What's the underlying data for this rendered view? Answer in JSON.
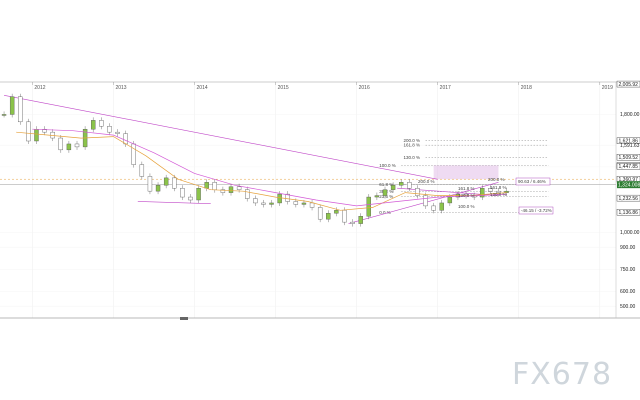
{
  "chart_data": {
    "type": "line",
    "title": "",
    "xlabel": "",
    "ylabel": "",
    "x_tick_labels": [
      "2012",
      "2013",
      "2014",
      "2015",
      "2016",
      "2017",
      "2018",
      "2019"
    ],
    "x_range": [
      2011.6,
      2019.2
    ],
    "y_range": [
      420,
      2020
    ],
    "y_price_labels": [
      {
        "value": 2005.92,
        "text": "2,005.92",
        "style": "box"
      },
      {
        "value": 1800,
        "text": "1,800.00",
        "style": "plain"
      },
      {
        "value": 1621.86,
        "text": "1,621.86",
        "style": "box"
      },
      {
        "value": 1591.63,
        "text": "1,591.63",
        "style": "plain"
      },
      {
        "value": 1509.52,
        "text": "1,509.52",
        "style": "box"
      },
      {
        "value": 1444.43,
        "text": "1,444.43",
        "style": "plain"
      },
      {
        "value": 1454.55,
        "text": "1,454.55",
        "style": "box"
      },
      {
        "value": 1447.85,
        "text": "1,447.85",
        "style": "box"
      },
      {
        "value": 1360.97,
        "text": "1,360.97",
        "style": "box"
      },
      {
        "value": 1324.008,
        "text": "1,324.008",
        "style": "current"
      },
      {
        "value": 1232.56,
        "text": "1,232.56",
        "style": "box"
      },
      {
        "value": 1136.86,
        "text": "1,136.86",
        "style": "box"
      },
      {
        "value": 1000,
        "text": "1,000.00",
        "style": "plain"
      },
      {
        "value": 900,
        "text": "900.00",
        "style": "plain"
      },
      {
        "value": 750,
        "text": "750.00",
        "style": "plain"
      },
      {
        "value": 600,
        "text": "600.00",
        "style": "plain"
      },
      {
        "value": 500,
        "text": "500.00",
        "style": "plain"
      }
    ],
    "fib_levels": [
      {
        "label": "200.0 %",
        "value": 1621.86
      },
      {
        "label": "161.8 %",
        "value": 1591.63
      },
      {
        "label": "130.0 %",
        "value": 1509.52
      },
      {
        "label": "100.0 %",
        "value": 1454.55
      },
      {
        "label": "61.8 %",
        "value": 1324.0
      },
      {
        "label": "38.2 %",
        "value": 1276.0
      },
      {
        "label": "23.6 %",
        "value": 1245.0
      },
      {
        "label": "0.0 %",
        "value": 1136.86
      }
    ],
    "annotations": [
      {
        "text": "200.0 %"
      },
      {
        "text": "200.0 %"
      },
      {
        "text": "161.8 %"
      },
      {
        "text": "161.8 %"
      },
      {
        "text": "130.0 %"
      },
      {
        "text": "130.0 %"
      },
      {
        "text": "100.0 %"
      },
      {
        "text": "90.63 / 6.46%"
      },
      {
        "text": "-46.15 / -3.72%"
      }
    ],
    "series": [
      {
        "name": "",
        "color": "#8bc34a",
        "style": "candles",
        "x": [
          2011.65,
          2011.75,
          2011.85,
          2011.95,
          2012.05,
          2012.15,
          2012.25,
          2012.35,
          2012.45,
          2012.55,
          2012.65,
          2012.75,
          2012.85,
          2012.95,
          2013.05,
          2013.15,
          2013.25,
          2013.35,
          2013.45,
          2013.55,
          2013.65,
          2013.75,
          2013.85,
          2013.95,
          2014.05,
          2014.15,
          2014.25,
          2014.35,
          2014.45,
          2014.55,
          2014.65,
          2014.75,
          2014.85,
          2014.95,
          2015.05,
          2015.15,
          2015.25,
          2015.35,
          2015.45,
          2015.55,
          2015.65,
          2015.75,
          2015.85,
          2015.95,
          2016.05,
          2016.15,
          2016.25,
          2016.35,
          2016.45,
          2016.55,
          2016.65,
          2016.75,
          2016.85,
          2016.95,
          2017.05,
          2017.15,
          2017.25,
          2017.35,
          2017.45,
          2017.55,
          2017.65,
          2017.75,
          2017.85
        ],
        "y": [
          1800,
          1920,
          1750,
          1620,
          1700,
          1680,
          1640,
          1560,
          1600,
          1580,
          1700,
          1760,
          1720,
          1680,
          1670,
          1600,
          1460,
          1380,
          1280,
          1320,
          1370,
          1300,
          1240,
          1220,
          1300,
          1340,
          1290,
          1270,
          1310,
          1290,
          1230,
          1200,
          1190,
          1200,
          1260,
          1210,
          1190,
          1200,
          1170,
          1090,
          1130,
          1150,
          1070,
          1060,
          1110,
          1240,
          1250,
          1290,
          1320,
          1340,
          1300,
          1250,
          1180,
          1150,
          1200,
          1240,
          1260,
          1250,
          1240,
          1300,
          1280,
          1270,
          1280
        ]
      },
      {
        "name": "",
        "color": "#e6a23c",
        "style": "line",
        "x": [
          2011.8,
          2012.2,
          2012.6,
          2013.0,
          2013.4,
          2013.8,
          2014.2,
          2014.6,
          2015.0,
          2015.4,
          2015.8,
          2016.2,
          2016.6,
          2017.0,
          2017.4,
          2017.85
        ],
        "y": [
          1680,
          1660,
          1640,
          1650,
          1520,
          1360,
          1290,
          1280,
          1240,
          1210,
          1150,
          1170,
          1270,
          1250,
          1250,
          1270
        ]
      },
      {
        "name": "",
        "color": "#d35ad6",
        "style": "line",
        "x": [
          2012.0,
          2012.5,
          2013.0,
          2013.5,
          2014.0,
          2014.5,
          2015.0,
          2015.5,
          2016.0,
          2016.5,
          2017.0,
          2017.5,
          2017.85
        ],
        "y": [
          1700,
          1690,
          1660,
          1540,
          1400,
          1320,
          1270,
          1220,
          1180,
          1210,
          1240,
          1250,
          1260
        ]
      }
    ]
  }
}
